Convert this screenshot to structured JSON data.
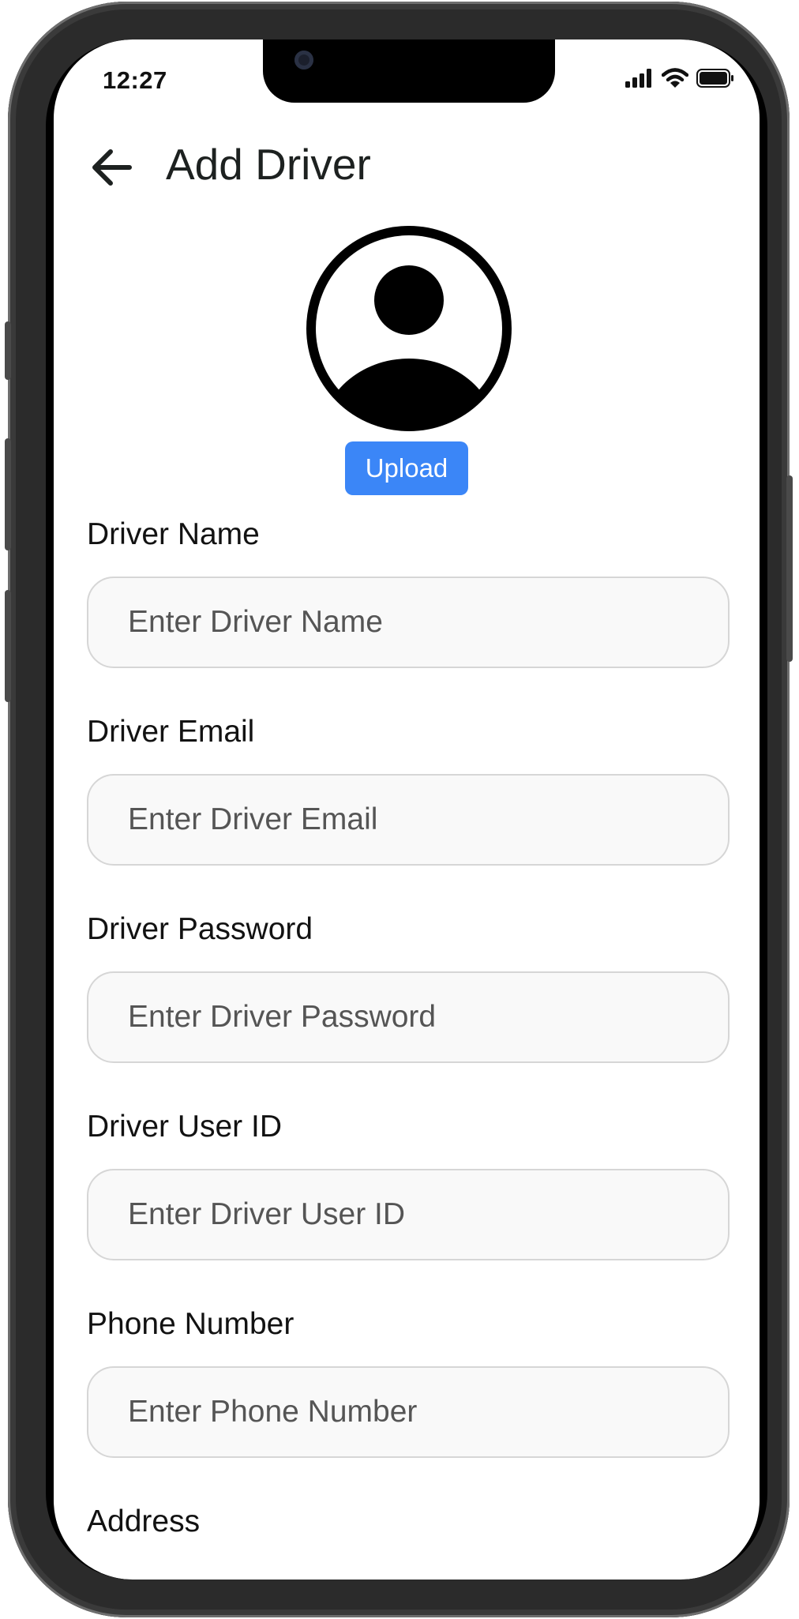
{
  "status_bar": {
    "time": "12:27",
    "icons": [
      "signal-icon",
      "wifi-icon",
      "battery-icon"
    ]
  },
  "header": {
    "back_icon": "arrow-left-icon",
    "title": "Add Driver"
  },
  "avatar": {
    "icon": "user-avatar-icon",
    "upload_label": "Upload"
  },
  "form": {
    "fields": [
      {
        "label": "Driver Name",
        "placeholder": "Enter Driver Name",
        "value": ""
      },
      {
        "label": "Driver Email",
        "placeholder": "Enter Driver Email",
        "value": ""
      },
      {
        "label": "Driver Password",
        "placeholder": "Enter Driver Password",
        "value": ""
      },
      {
        "label": "Driver User ID",
        "placeholder": "Enter Driver User ID",
        "value": ""
      },
      {
        "label": "Phone Number",
        "placeholder": "Enter Phone Number",
        "value": ""
      },
      {
        "label": "Address"
      }
    ]
  },
  "colors": {
    "primary": "#3b86f7",
    "input_background": "#f9f9f9",
    "input_border": "#d6d6d6",
    "text": "#121212"
  }
}
